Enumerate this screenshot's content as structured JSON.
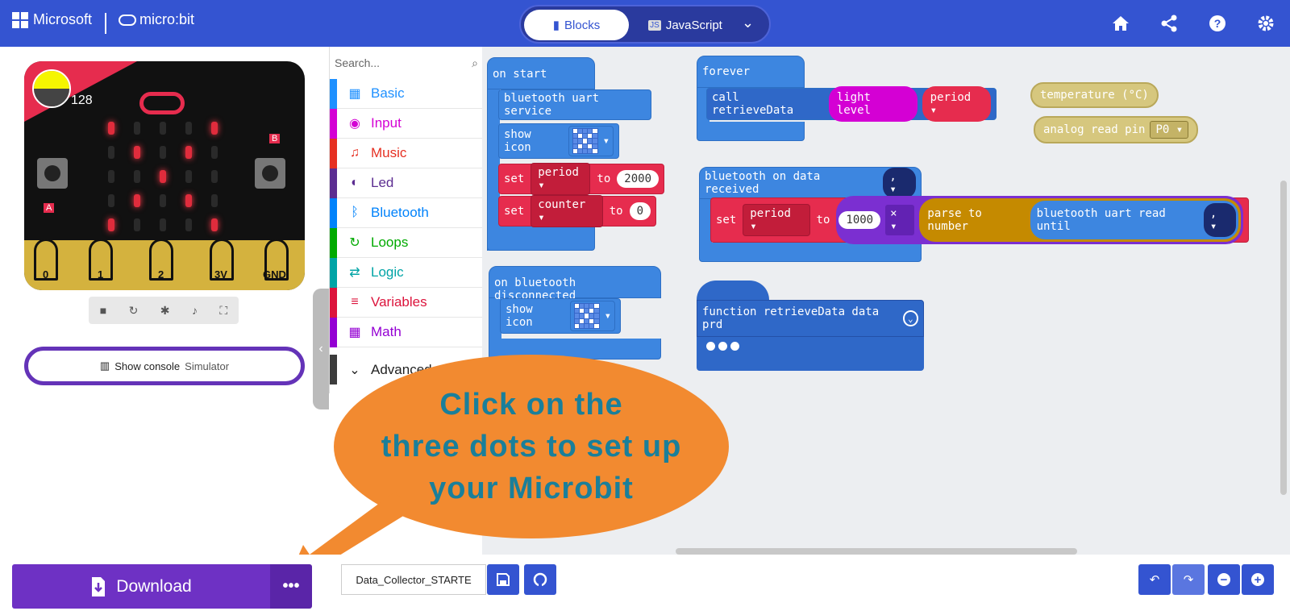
{
  "header": {
    "brand": "Microsoft",
    "product": "micro:bit",
    "tab_blocks": "Blocks",
    "tab_js": "JavaScript",
    "icons": [
      "home-icon",
      "share-icon",
      "help-icon",
      "settings-icon"
    ]
  },
  "simulator": {
    "light_value": "128",
    "button_a": "A",
    "button_b": "B",
    "pins": [
      "0",
      "1",
      "2",
      "3V",
      "GND"
    ],
    "console_label": "Show console",
    "console_sub": "Simulator"
  },
  "toolbox": {
    "search_placeholder": "Search...",
    "categories": [
      {
        "label": "Basic",
        "color": "#1e90ff"
      },
      {
        "label": "Input",
        "color": "#d400d4"
      },
      {
        "label": "Music",
        "color": "#e63022"
      },
      {
        "label": "Led",
        "color": "#5c2d91"
      },
      {
        "label": "Bluetooth",
        "color": "#0082fb"
      },
      {
        "label": "Loops",
        "color": "#00aa00"
      },
      {
        "label": "Logic",
        "color": "#00a4a6"
      },
      {
        "label": "Variables",
        "color": "#dc143c"
      },
      {
        "label": "Math",
        "color": "#9400d3"
      },
      {
        "label": "Advanced",
        "color": "#3c3c3c"
      }
    ]
  },
  "blocks": {
    "on_start": "on start",
    "bt_uart": "bluetooth uart service",
    "show_icon": "show icon",
    "set": "set",
    "period": "period",
    "counter": "counter",
    "to": "to",
    "val_2000": "2000",
    "val_0": "0",
    "forever": "forever",
    "call": "call retrieveData",
    "light_level": "light level",
    "bt_received": "bluetooth on data received",
    "comma": ",",
    "val_1000": "1000",
    "times": "×",
    "parse": "parse to number",
    "uart_read": "bluetooth uart read until",
    "bt_disconnected": "on bluetooth disconnected",
    "function": "function retrieveData data prd",
    "temperature": "temperature (°C)",
    "analog": "analog read pin",
    "p0": "P0"
  },
  "callout": {
    "line1": "Click on the",
    "line2": "three dots to set up",
    "line3": "your Microbit"
  },
  "bottom": {
    "download": "Download",
    "filename": "Data_Collector_STARTE"
  }
}
